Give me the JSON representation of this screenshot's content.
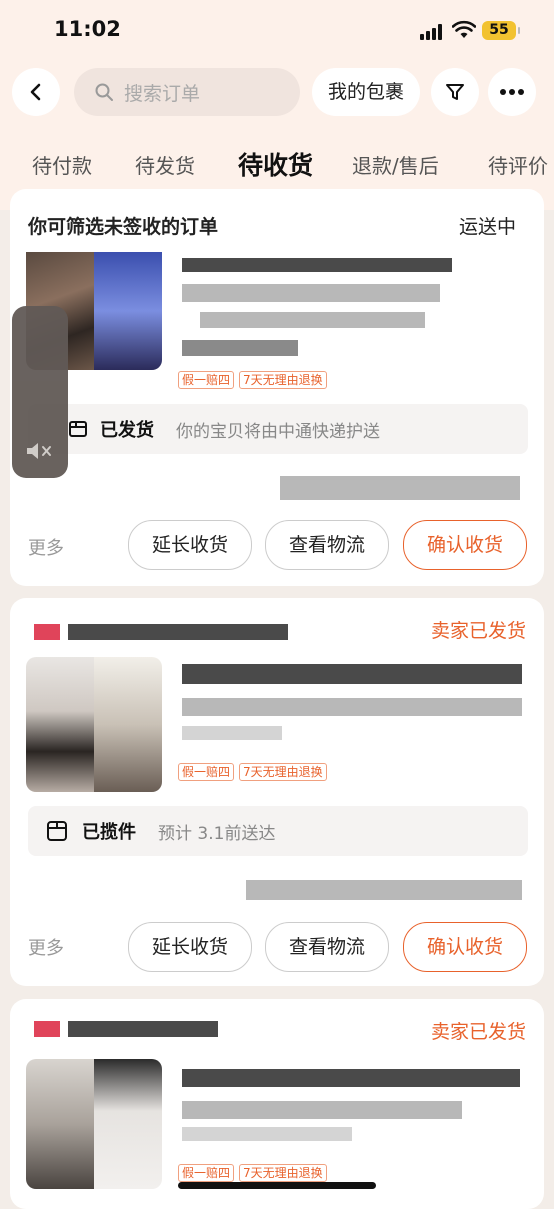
{
  "status_bar": {
    "time": "11:02",
    "battery": "55"
  },
  "nav": {
    "search_placeholder": "搜索订单",
    "packages_label": "我的包裹",
    "back_icon": "chevron-left-icon",
    "filter_icon": "funnel-icon",
    "more_icon": "ellipsis-icon"
  },
  "tabs": [
    {
      "label": "待付款"
    },
    {
      "label": "待发货"
    },
    {
      "label": "待收货",
      "active": true
    },
    {
      "label": "退款/售后"
    },
    {
      "label": "待评价"
    }
  ],
  "filter": {
    "title": "你可筛选未签收的订单",
    "status": "运送中"
  },
  "orders": [
    {
      "status": "",
      "tags": [
        "假一赔四",
        "7天无理由退换"
      ],
      "shipping_status": "已发货",
      "shipping_note": "你的宝贝将由中通快递护送",
      "more_label": "更多",
      "buttons": [
        "延长收货",
        "查看物流",
        "确认收货"
      ]
    },
    {
      "status": "卖家已发货",
      "tags": [
        "假一赔四",
        "7天无理由退换"
      ],
      "shipping_status": "已揽件",
      "shipping_note": "预计 3.1前送达",
      "more_label": "更多",
      "buttons": [
        "延长收货",
        "查看物流",
        "确认收货"
      ]
    },
    {
      "status": "卖家已发货",
      "tags": [
        "假一赔四",
        "7天无理由退换"
      ]
    }
  ],
  "colors": {
    "accent": "#e8622c",
    "background": "#f3ede8",
    "battery": "#f2c230"
  }
}
